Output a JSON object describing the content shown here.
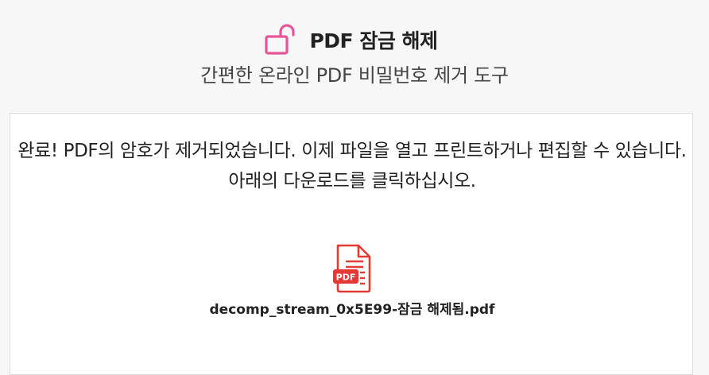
{
  "header": {
    "title": "PDF 잠금 해제",
    "subtitle": "간편한 온라인 PDF 비밀번호 제거 도구",
    "icon": "unlocked-padlock-icon",
    "accent_color": "#e8569a"
  },
  "result": {
    "message": "완료! PDF의 암호가 제거되었습니다. 이제 파일을 열고 프린트하거나 편집할 수 있습니다. 아래의 다운로드를 클릭하십시오.",
    "file_icon": "pdf-file-icon",
    "file_icon_label": "PDF",
    "file_icon_color": "#e53935",
    "file_name": "decomp_stream_0x5E99-잠금 해제됨.pdf"
  }
}
